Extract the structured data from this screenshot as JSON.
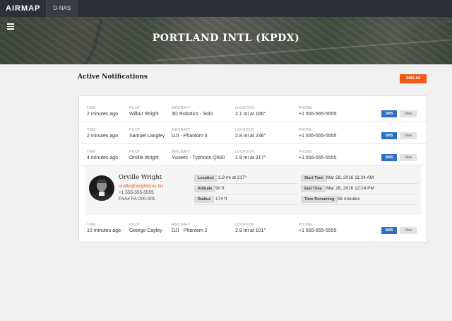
{
  "header": {
    "logo": "AIRMAP",
    "nav_tab": "D-NAS"
  },
  "hero": {
    "title": "PORTLAND INTL (KPDX)"
  },
  "section": {
    "title": "Active Notifications",
    "sms_all_label": "SMS All"
  },
  "columns": {
    "time": "TIME",
    "pilot": "PILOT",
    "aircraft": "AIRCRAFT",
    "location": "LOCATION",
    "phone": "PHONE"
  },
  "buttons": {
    "sms": "SMS",
    "view": "View"
  },
  "rows": [
    {
      "time": "2 minutes ago",
      "pilot": "Wilbur Wright",
      "aircraft": "3D Robotics - Solo",
      "location": "2.1 mi at 166°",
      "phone": "+1 555-555-5555"
    },
    {
      "time": "2 minutes ago",
      "pilot": "Samuel Langley",
      "aircraft": "DJI - Phantom 3",
      "location": "2.8 mi at 236°",
      "phone": "+1 555-555-5555"
    },
    {
      "time": "4 minutes ago",
      "pilot": "Orville Wright",
      "aircraft": "Yuneec - Typhoon Q500",
      "location": "1.9 mi at 217°",
      "phone": "+1 555-555-5555"
    },
    {
      "time": "10 minutes ago",
      "pilot": "George Cayley",
      "aircraft": "DJI - Phantom 2",
      "location": "2.9 mi at 101°",
      "phone": "+1 555-555-5555"
    }
  ],
  "detail": {
    "name": "Orville Wright",
    "email": "orville@wrightbros.biz",
    "phone": "+1 555-555-5555",
    "faa": "FAA# FA-000-001",
    "location_label": "Location",
    "location": "1.9 mi at 217°",
    "altitude_label": "Altitude",
    "altitude": "90 ft",
    "radius_label": "Radius",
    "radius": "174 ft",
    "start_label": "Start Time",
    "start": "Mar 28, 2016 11:24 AM",
    "end_label": "End Time",
    "end": "Mar 28, 2016 12:24 PM",
    "remaining_label": "Time Remaining",
    "remaining": "56 minutes"
  }
}
